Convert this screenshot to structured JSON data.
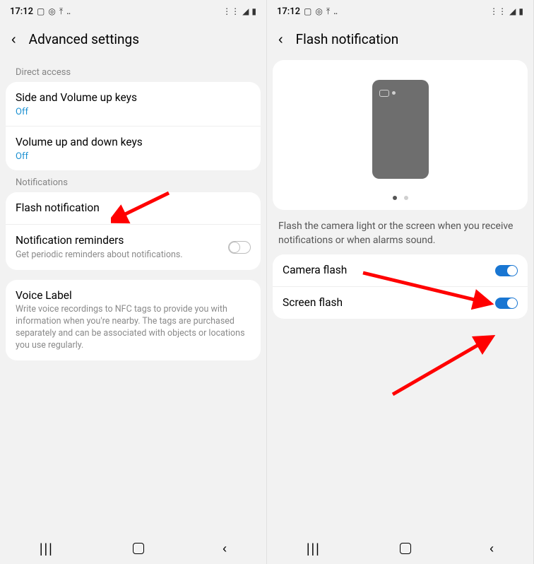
{
  "left": {
    "status": {
      "time": "17:12"
    },
    "header": {
      "title": "Advanced settings"
    },
    "sections": {
      "direct_access": {
        "label": "Direct access",
        "items": [
          {
            "title": "Side and Volume up keys",
            "status": "Off"
          },
          {
            "title": "Volume up and down keys",
            "status": "Off"
          }
        ]
      },
      "notifications": {
        "label": "Notifications",
        "items": [
          {
            "title": "Flash notification"
          },
          {
            "title": "Notification reminders",
            "desc": "Get periodic reminders about notifications."
          }
        ]
      },
      "voice": {
        "title": "Voice Label",
        "desc": "Write voice recordings to NFC tags to provide you with information when you're nearby. The tags are purchased separately and can be associated with objects or locations you use regularly."
      }
    }
  },
  "right": {
    "status": {
      "time": "17:12"
    },
    "header": {
      "title": "Flash notification"
    },
    "description": "Flash the camera light or the screen when you receive notifications or when alarms sound.",
    "toggles": [
      {
        "title": "Camera flash",
        "on": true
      },
      {
        "title": "Screen flash",
        "on": true
      }
    ]
  }
}
